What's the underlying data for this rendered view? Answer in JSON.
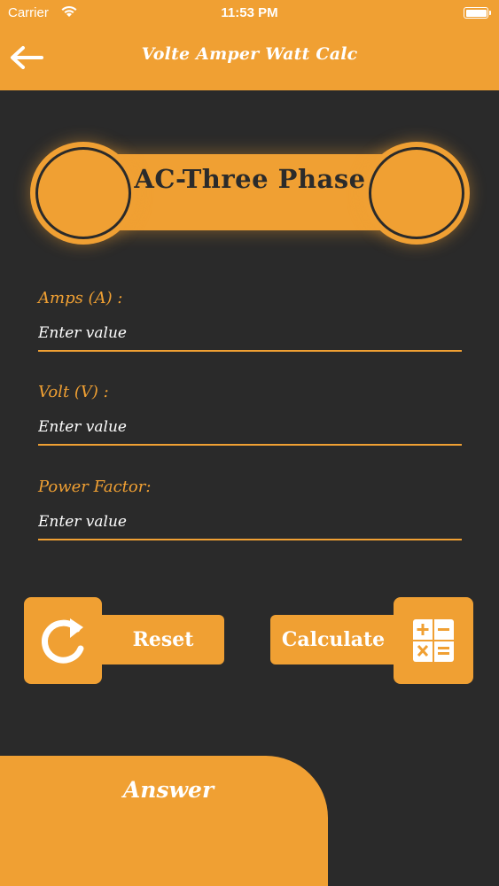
{
  "status_bar": {
    "carrier": "Carrier",
    "time": "11:53 PM"
  },
  "nav": {
    "title": "Volte Amper Watt Calc",
    "back_icon": "arrow-left-icon"
  },
  "banner": {
    "title": "AC-Three Phase"
  },
  "fields": [
    {
      "label": "Amps (A) :",
      "placeholder": "Enter value"
    },
    {
      "label": "Volt (V) :",
      "placeholder": "Enter value"
    },
    {
      "label": "Power Factor:",
      "placeholder": "Enter value"
    }
  ],
  "buttons": {
    "reset": {
      "label": "Reset",
      "icon": "refresh-icon"
    },
    "calculate": {
      "label": "Calculate",
      "icon": "calculator-icon"
    }
  },
  "answer": {
    "label": "Answer"
  },
  "colors": {
    "accent": "#f0a033",
    "background": "#2a2a2a",
    "text_light": "#ffffff",
    "text_dark": "#2b2b2b"
  }
}
